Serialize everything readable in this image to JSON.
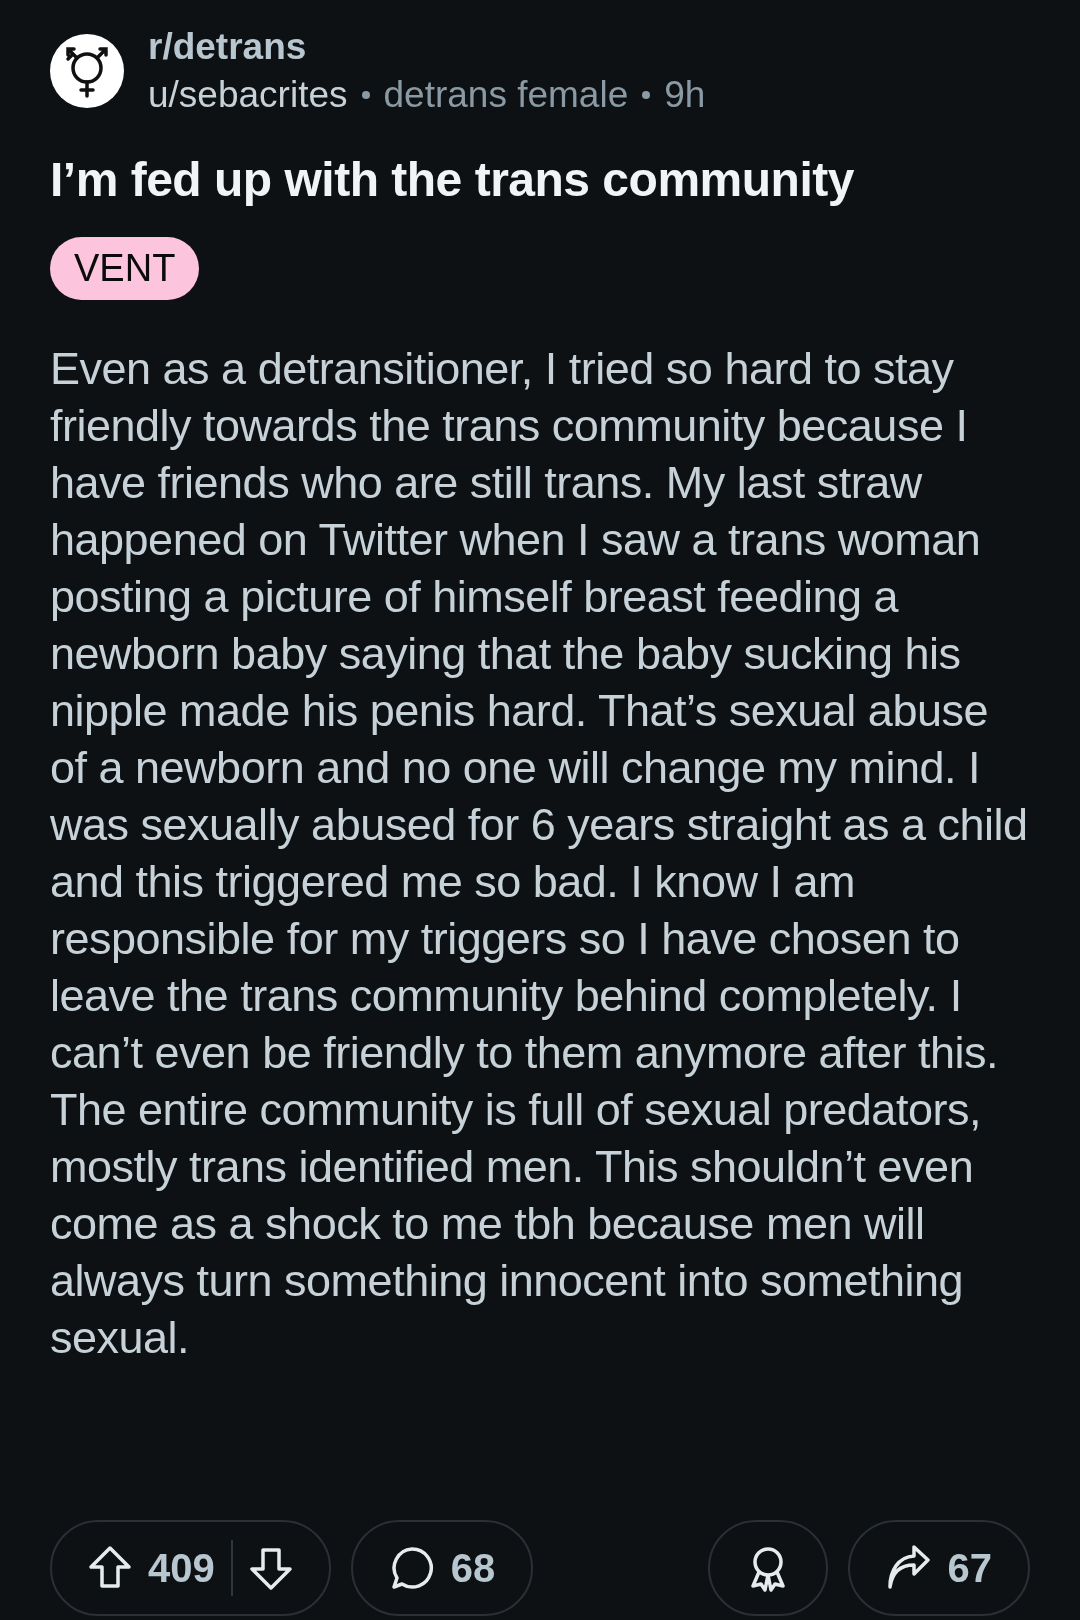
{
  "post": {
    "subreddit": "r/detrans",
    "author": "u/sebacrites",
    "flair": "detrans female",
    "age": "9h",
    "title": "I’m fed up with the trans community",
    "tag": "VENT",
    "body": "Even as a detransitioner, I tried so hard to stay friendly towards the trans community because I have friends who are still trans. My last straw happened on Twitter when I saw a trans woman posting a picture of himself breast feeding a newborn baby saying that the baby sucking his nipple made his penis hard. That’s sexual abuse of a newborn and no one will change my mind. I was sexually abused for 6 years straight as a child and this triggered me so bad. I know I am responsible for my triggers so I have chosen to leave the trans community behind completely. I can’t even be friendly to them anymore after this. The entire community is full of sexual predators, mostly trans identified men. This shouldn’t even come as a shock to me tbh because men will always turn something innocent into something sexual."
  },
  "actions": {
    "votes": "409",
    "comments": "68",
    "shares": "67"
  }
}
